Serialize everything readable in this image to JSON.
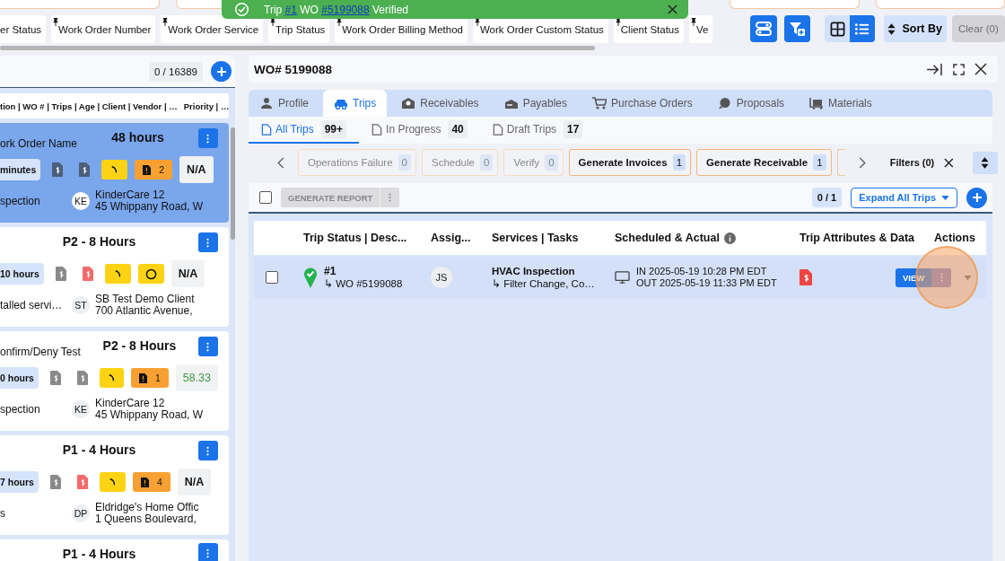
{
  "toast": {
    "parts": [
      {
        "text": "Trip ",
        "link": false
      },
      {
        "text": "#1",
        "link": true
      },
      {
        "text": " WO ",
        "link": false
      },
      {
        "text": "#5199088",
        "link": true
      },
      {
        "text": " Verified",
        "link": false
      }
    ]
  },
  "filter_chips": [
    {
      "label": "er Status",
      "pinned": false
    },
    {
      "label": "Work Order Number",
      "pinned": true
    },
    {
      "label": "Work Order Service",
      "pinned": true
    },
    {
      "label": "Trip Status",
      "pinned": true
    },
    {
      "label": "Work Order Billing Method",
      "pinned": true
    },
    {
      "label": "Work Order Custom Status",
      "pinned": true
    },
    {
      "label": "Client Status",
      "pinned": true
    },
    {
      "label": "Ve",
      "pinned": true
    }
  ],
  "view_toggle": [
    {
      "kind": "grid",
      "selected": false
    },
    {
      "kind": "list",
      "selected": true
    }
  ],
  "sort_button": "Sort By",
  "clear_button": {
    "label": "Clear (0)",
    "disabled": true
  },
  "work_orders": {
    "count": "0 / 16389",
    "columns_header": "tion | WO # | Trips | Age | Client | Vendor | …",
    "priority_header": "Priority | …",
    "cards": [
      {
        "name": "ork Order Name",
        "priority": "48 hours",
        "age": "minutes",
        "docs": [
          {
            "color": "#4d5e7a"
          },
          {
            "color": "#4d5e7a"
          }
        ],
        "status": {
          "kind": "count",
          "count": "2"
        },
        "metric": {
          "kind": "na",
          "text": "N/A"
        },
        "service": "spection",
        "initials": "KE",
        "client": "KinderCare 12",
        "address": "45 Whippany Road, W",
        "selected": true
      },
      {
        "priority": "P2 - 8 Hours",
        "age": "10 hours",
        "docs": [
          {
            "color": "#8a8a8a"
          },
          {
            "color": "#f26b6b"
          }
        ],
        "status": {
          "kind": "pending"
        },
        "metric": {
          "kind": "na",
          "text": "N/A"
        },
        "service": "talled servi…",
        "initials": "ST",
        "client": "SB Test Demo Client",
        "address": "700 Atlantic Avenue,",
        "selected": false
      },
      {
        "name": "onfirm/Deny Test",
        "priority": "P2 - 8 Hours",
        "age": "0 hours",
        "docs": [
          {
            "color": "#8a8a8a"
          },
          {
            "color": "#8a8a8a"
          }
        ],
        "status": {
          "kind": "count",
          "count": "1"
        },
        "metric": {
          "kind": "percent",
          "text": "58.33"
        },
        "service": "spection",
        "initials": "KE",
        "client": "KinderCare 12",
        "address": "45 Whippany Road, W",
        "selected": false
      },
      {
        "priority": "P1 - 4 Hours",
        "age": "7 hours",
        "docs": [
          {
            "color": "#8a8a8a"
          },
          {
            "color": "#f26b6b"
          }
        ],
        "status": {
          "kind": "count",
          "count": "4"
        },
        "metric": {
          "kind": "na",
          "text": "N/A"
        },
        "service": "s",
        "initials": "DP",
        "client": "Eldridge's Home Offic",
        "address": "1 Queens Boulevard,",
        "selected": false
      },
      {
        "priority": "P1 - 4 Hours",
        "selected": false
      }
    ]
  },
  "detail": {
    "title": "WO# 5199088",
    "tabs": [
      {
        "label": "Profile",
        "kind": "person",
        "selected": false
      },
      {
        "label": "Trips",
        "kind": "car",
        "selected": true
      },
      {
        "label": "Receivables",
        "kind": "receivable",
        "selected": false
      },
      {
        "label": "Payables",
        "kind": "payable",
        "selected": false
      },
      {
        "label": "Purchase Orders",
        "kind": "cart",
        "selected": false
      },
      {
        "label": "Proposals",
        "kind": "chat",
        "selected": false
      },
      {
        "label": "Materials",
        "kind": "materials",
        "selected": false
      }
    ],
    "subtabs": [
      {
        "label": "All Trips",
        "count": "99+",
        "selected": true
      },
      {
        "label": "In Progress",
        "count": "40",
        "selected": false
      },
      {
        "label": "Draft Trips",
        "count": "17",
        "selected": false
      }
    ],
    "stages": [
      {
        "label": "Operations Failure",
        "count": "0",
        "kind": "empty"
      },
      {
        "label": "Schedule",
        "count": "0",
        "kind": "empty"
      },
      {
        "label": "Verify",
        "count": "0",
        "kind": "empty"
      },
      {
        "label": "Generate Invoices",
        "count": "1",
        "kind": "pending"
      },
      {
        "label": "Generate Receivable",
        "count": "1",
        "kind": "pending"
      }
    ],
    "select_all_checked": false,
    "filters_label": "Filters (0)",
    "report_button": {
      "label": "GENERATE REPORT",
      "disabled": true
    },
    "selection": "0 / 1",
    "expand_button": "Expand All Trips",
    "table": {
      "columns": [
        {
          "label": "Trip Status | Desc..."
        },
        {
          "label": "Assig..."
        },
        {
          "label": "Services | Tasks"
        },
        {
          "label": "Scheduled & Actual",
          "info": true
        },
        {
          "label": "Trip Attributes & Data"
        },
        {
          "label": "Actions"
        }
      ],
      "rows": [
        {
          "checked": false,
          "trip": "#1",
          "wo": "↳ WO #5199088",
          "initials": "JS",
          "service": "HVAC Inspection",
          "tasks": "↳ Filter Change, Co…",
          "in": "IN 2025-05-19 10:28 PM EDT",
          "out": "OUT 2025-05-19 11:33 PM EDT",
          "view": "VIEW"
        }
      ]
    }
  }
}
